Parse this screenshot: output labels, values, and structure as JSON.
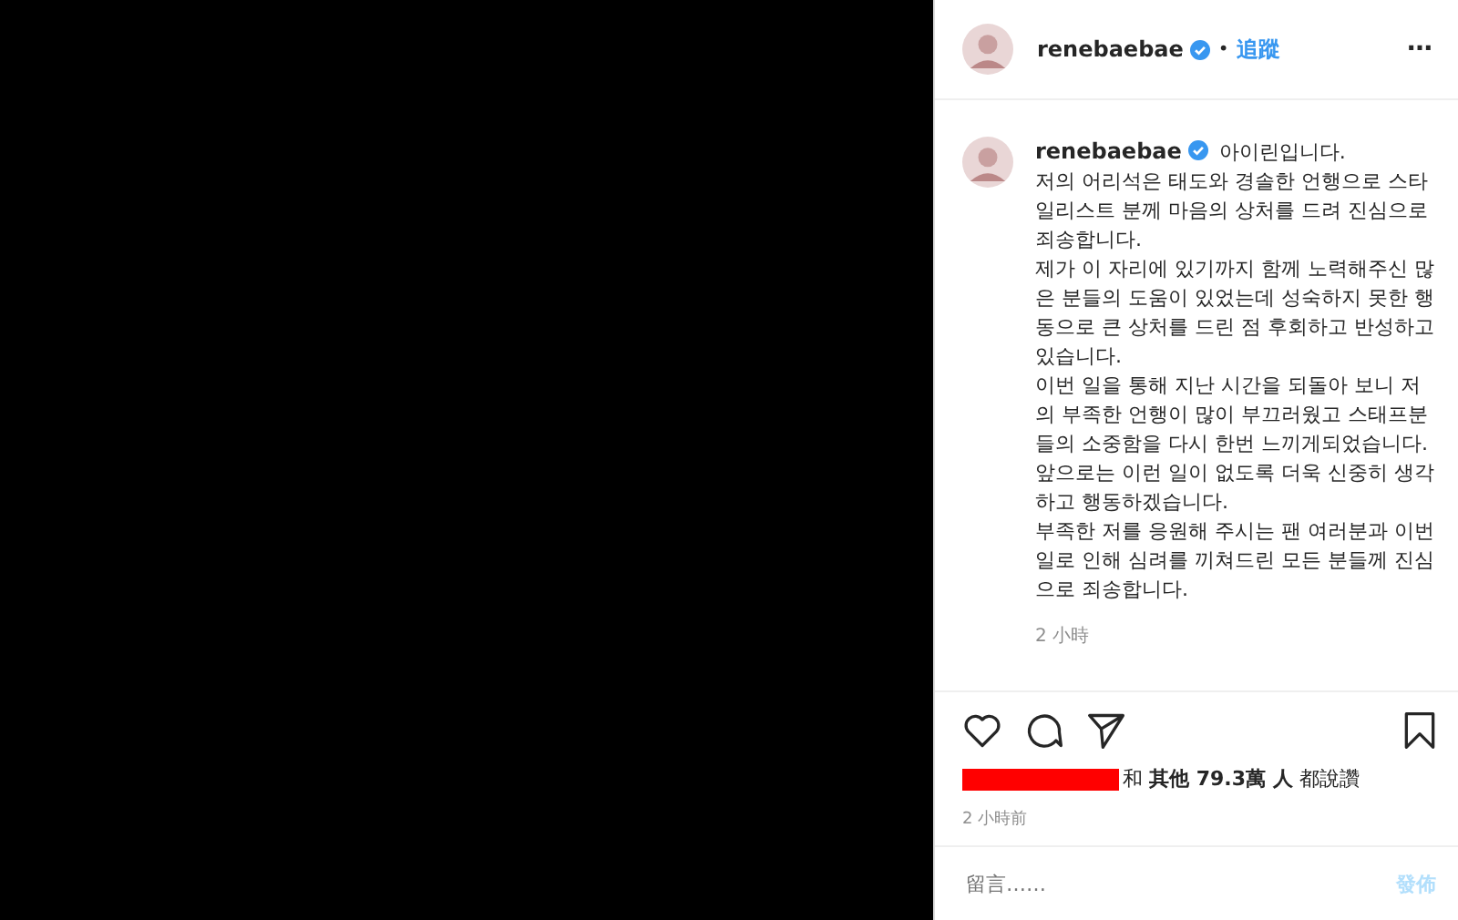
{
  "header": {
    "username": "renebaebae",
    "verified": true,
    "separator": "•",
    "follow": "追蹤",
    "more": "⋯"
  },
  "caption": {
    "username": "renebaebae",
    "verified": true,
    "lines": [
      "아이린입니다.",
      "저의 어리석은 태도와 경솔한 언행으로 스타",
      "일리스트 분께 마음의 상처를 드려 진심으로",
      "죄송합니다.",
      "제가 이 자리에 있기까지 함께 노력해주신 많",
      "은 분들의 도움이 있었는데 성숙하지 못한 행",
      "동으로 큰 상처를 드린 점 후회하고 반성하고",
      "있습니다.",
      "이번 일을 통해 지난 시간을 되돌아 보니 저",
      "의 부족한 언행이 많이 부끄러웠고 스태프분",
      "들의 소중함을 다시 한번 느끼게되었습니다.",
      "앞으로는 이런 일이 없도록 더욱 신중히 생각",
      "하고 행동하겠습니다.",
      "부족한 저를 응원해 주시는 팬 여러분과 이번",
      "일로 인해 심려를 끼쳐드린 모든 분들께 진심",
      "으로 죄송합니다."
    ],
    "time": "2 小時"
  },
  "likes": {
    "text": "和 **其他 79.3萬 人** 都說讚"
  },
  "time": "2 小時前",
  "comment": {
    "placeholder": "留言……",
    "post": "發佈",
    "post_disabled": true
  }
}
